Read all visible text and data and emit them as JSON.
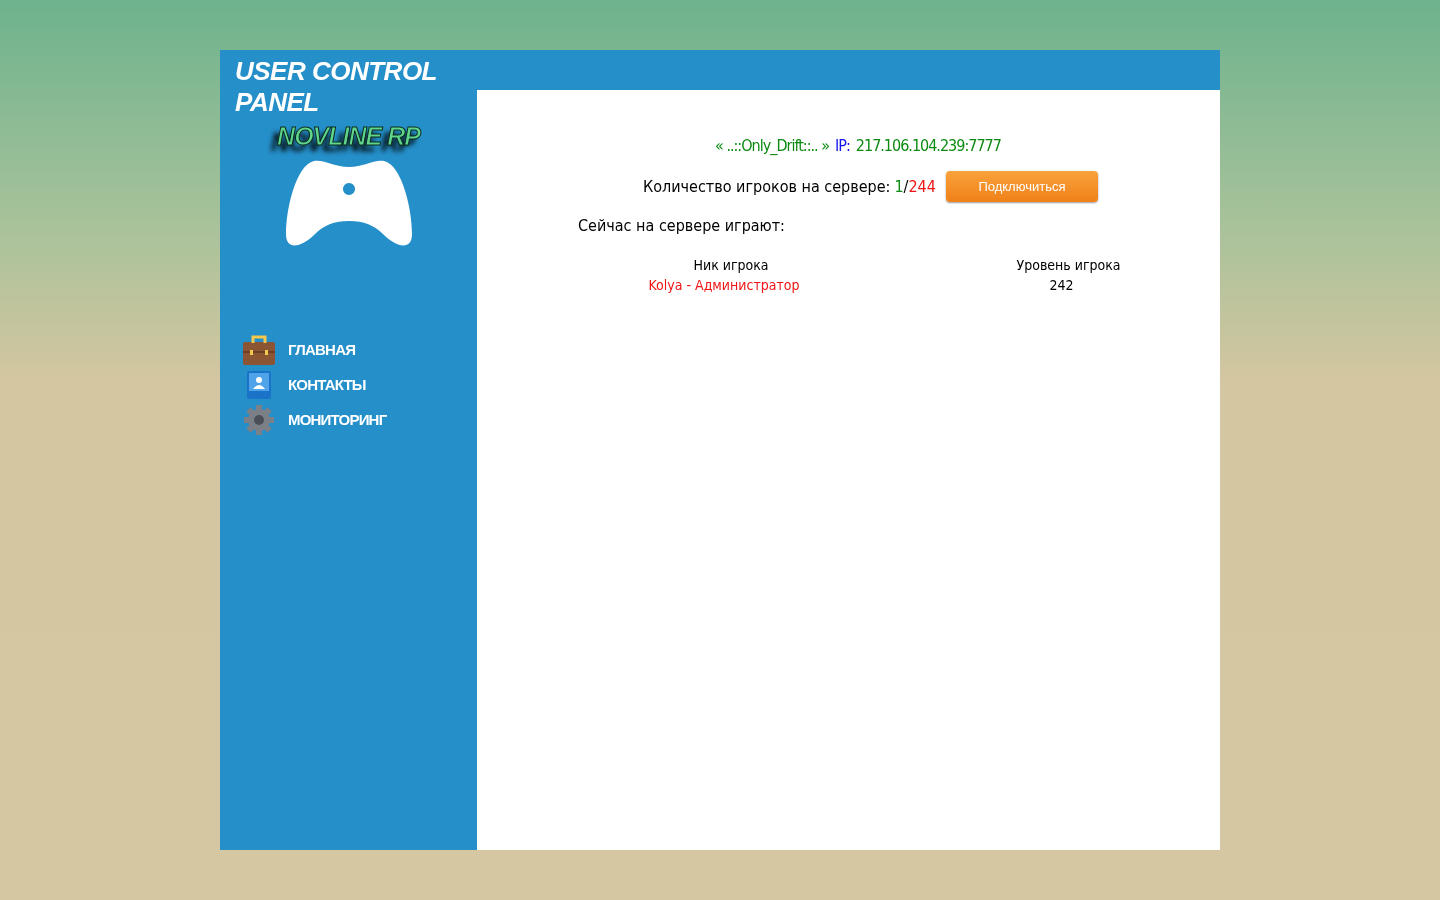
{
  "header": {
    "title": "USER CONTROL PANEL"
  },
  "sidebar": {
    "logo": "NOVLINE RP",
    "nav": [
      {
        "label": "ГЛАВНАЯ",
        "kind": "briefcase"
      },
      {
        "label": "КОНТАКТЫ",
        "kind": "contact"
      },
      {
        "label": "МОНИТОРИНГ",
        "kind": "gear"
      }
    ]
  },
  "server": {
    "name": "« ..::Only_Drift::.. »",
    "ip_label": "IP:",
    "ip": "217.106.104.239:7777"
  },
  "players": {
    "label": "Количество игроков на сервере:",
    "online": "1",
    "separator": "/",
    "max": "244",
    "connect_button": "Подключиться"
  },
  "playing_title": "Сейчас на сервере играют:",
  "table": {
    "columns": [
      "Ник игрока",
      "Уровень игрока"
    ],
    "rows": [
      {
        "cells": [
          "Kolya - Администратор",
          "242"
        ]
      }
    ]
  }
}
